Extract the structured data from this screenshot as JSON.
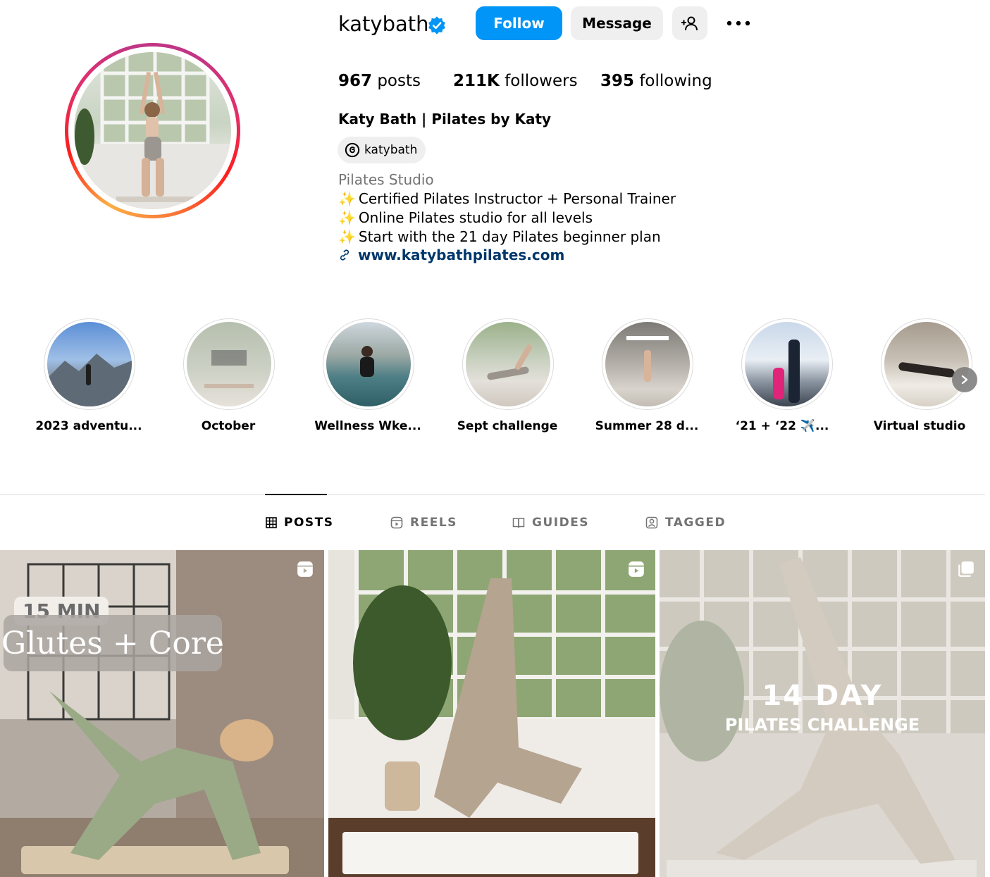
{
  "profile": {
    "username": "katybath",
    "follow_label": "Follow",
    "message_label": "Message",
    "stats": {
      "posts_count": "967",
      "posts_label": "posts",
      "followers_count": "211K",
      "followers_label": "followers",
      "following_count": "395",
      "following_label": "following"
    },
    "full_name": "Katy Bath | Pilates by Katy",
    "threads_handle": "katybath",
    "category": "Pilates Studio",
    "bio_lines": [
      "Certified Pilates Instructor + Personal Trainer",
      "Online Pilates studio for all levels",
      "Start with the 21 day Pilates beginner plan"
    ],
    "website": "www.katybathpilates.com"
  },
  "highlights": [
    {
      "label": "2023 adventu..."
    },
    {
      "label": "October"
    },
    {
      "label": "Wellness Wke..."
    },
    {
      "label": "Sept challenge"
    },
    {
      "label": "Summer 28 d..."
    },
    {
      "label": "‘21 + ‘22 ✈️..."
    },
    {
      "label": "Virtual studio"
    }
  ],
  "tabs": [
    {
      "label": "POSTS",
      "active": true
    },
    {
      "label": "REELS",
      "active": false
    },
    {
      "label": "GUIDES",
      "active": false
    },
    {
      "label": "TAGGED",
      "active": false
    }
  ],
  "posts": [
    {
      "overlay_top": "15 MIN",
      "overlay_main": "Glutes + Core",
      "type_icon": "reel-icon"
    },
    {
      "type_icon": "reel-icon"
    },
    {
      "overlay_top": "14 DAY",
      "overlay_main": "PILATES CHALLENGE",
      "type_icon": "carousel-icon"
    }
  ],
  "colors": {
    "follow_blue": "#0095f6",
    "link_navy": "#00376b",
    "secondary_gray": "#737373",
    "button_gray": "#efefef"
  }
}
